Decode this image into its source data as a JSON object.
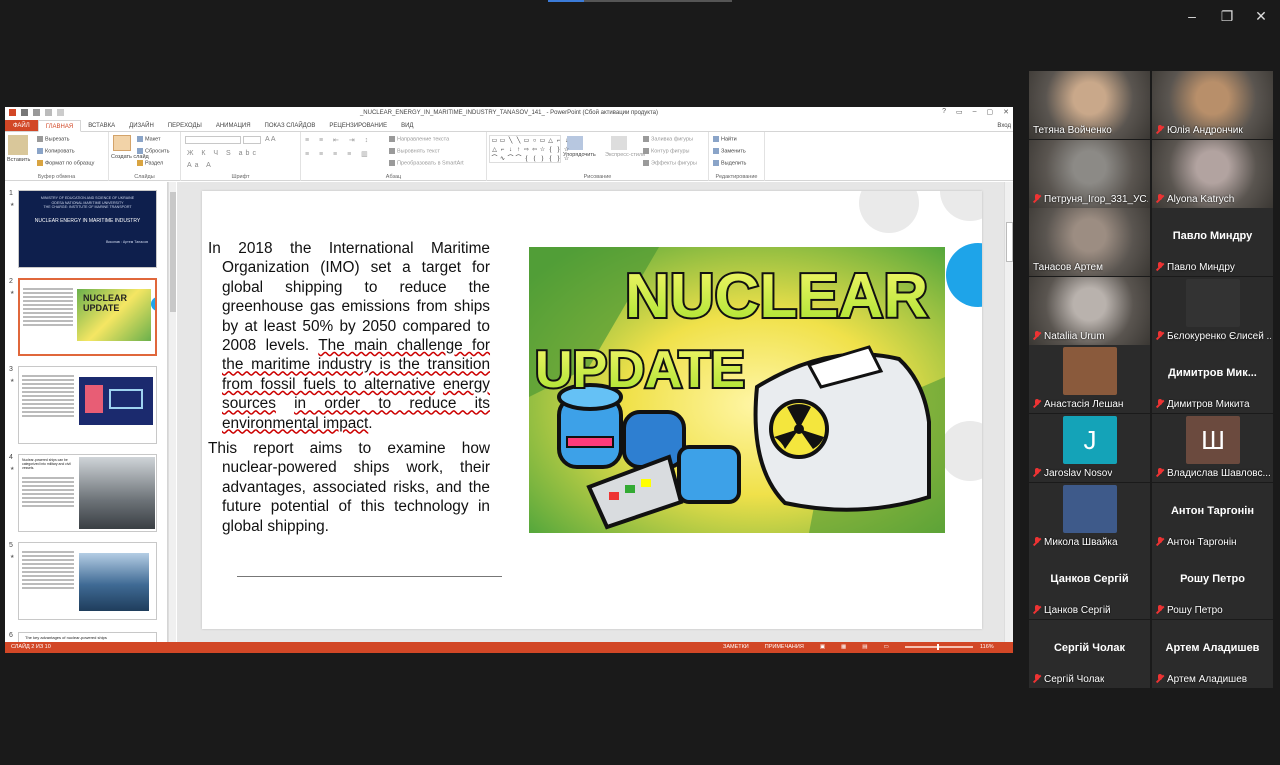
{
  "ppt": {
    "window_title": "_NUCLEAR_ENERGY_IN_MARITIME_INDUSTRY_TANASOV_141_ - PowerPoint (Сбой активации продукта)",
    "account": "Вход",
    "window_controls": [
      "?",
      "▭",
      "–",
      "▢",
      "✕"
    ],
    "tabs": [
      "ФАЙЛ",
      "ГЛАВНАЯ",
      "ВСТАВКА",
      "ДИЗАЙН",
      "ПЕРЕХОДЫ",
      "АНИМАЦИЯ",
      "ПОКАЗ СЛАЙДОВ",
      "РЕЦЕНЗИРОВАНИЕ",
      "ВИД"
    ],
    "active_tab": "ГЛАВНАЯ",
    "ribbon": {
      "clipboard": {
        "label": "Буфер обмена",
        "paste": "Вставить",
        "cut": "Вырезать",
        "copy": "Копировать",
        "format": "Формат по образцу"
      },
      "slides": {
        "label": "Слайды",
        "new_slide": "Создать слайд",
        "layout": "Макет",
        "reset": "Сбросить",
        "section": "Раздел"
      },
      "font": {
        "label": "Шрифт"
      },
      "paragraph": {
        "label": "Абзац",
        "text_dir": "Направление текста",
        "align_text": "Выровнять текст",
        "smartart": "Преобразовать в SmartArt"
      },
      "drawing": {
        "label": "Рисование",
        "arrange": "Упорядочить",
        "styles": "Экспресс-стили",
        "fill": "Заливка фигуры",
        "outline": "Контур фигуры",
        "effects": "Эффекты фигуры"
      },
      "editing": {
        "label": "Редактирование",
        "find": "Найти",
        "replace": "Заменить",
        "select": "Выделить"
      }
    },
    "thumbnails": [
      {
        "num": "1",
        "title_lines": [
          "MINISTRY OF EDUCATION AND SCIENCE OF UKRAINE",
          "ODESA NATIONAL MARITIME UNIVERSITY",
          "THE CHARGE: INSTITUTE OF MARINE TRANSPORT"
        ],
        "heading": "NUCLEAR ENERGY IN MARITIME INDUSTRY",
        "footer": "Виконав : Артем Танасов"
      },
      {
        "num": "2",
        "badge": "NUCLEAR UPDATE"
      },
      {
        "num": "3"
      },
      {
        "num": "4",
        "text": "Nuclear-powered ships can be categorized into military and civil vessels."
      },
      {
        "num": "5"
      },
      {
        "num": "6",
        "text": "The key advantages of nuclear-powered ships"
      }
    ],
    "slide": {
      "paragraph1_plain": "In 2018 the International Maritime Organization (IMO) set a target for global shipping to reduce the greenhouse gas emissions from ships by at least 50% by 2050 compared to 2008 levels.",
      "paragraph1_pre": "The main challenge for the maritime industry is the transition from fossil fuels to alternative",
      "paragraph1_energy": "energy sources",
      "paragraph1_post": "in order to reduce its environmental impact",
      "paragraph1_end": ".",
      "paragraph2": "This report aims to examine how nuclear-powered ships work, their advantages, associated risks, and the future potential of this technology in global shipping.",
      "image_line1": "NUCLEAR",
      "image_line2": "UPDATE"
    },
    "status": {
      "slide_counter": "СЛАЙД 2 ИЗ 10",
      "notes": "ЗАМЕТКИ",
      "comments": "ПРИМЕЧАНИЯ",
      "zoom": "116%"
    }
  },
  "participants": [
    {
      "name": "Тетяна Войченко",
      "muted": false,
      "kind": "photo",
      "color": "#c9a88a"
    },
    {
      "name": "Юлія Андрончик",
      "muted": true,
      "kind": "photo",
      "color": "#b88f6a"
    },
    {
      "name": "Петруня_Ігор_331_УС...",
      "muted": true,
      "kind": "photo",
      "color": "#8c8a86"
    },
    {
      "name": "Alyona Katrych",
      "muted": true,
      "kind": "photo",
      "color": "#b2a3a0"
    },
    {
      "name": "Танасов Артем",
      "muted": false,
      "kind": "photo",
      "color": "#9c8d82",
      "active": true
    },
    {
      "name": "Павло Миндру",
      "muted": true,
      "kind": "name",
      "display": "Павло Миндру"
    },
    {
      "name": "Nataliia Urum",
      "muted": true,
      "kind": "photo",
      "color": "#b9b2ad"
    },
    {
      "name": "Бєлокуренко Єлисей ...",
      "muted": true,
      "kind": "avatar",
      "letter": "",
      "color": "#333"
    },
    {
      "name": "Анастасія Лешан",
      "muted": true,
      "kind": "avatar",
      "letter": "",
      "color": "#8a5a3c"
    },
    {
      "name": "Димитров Микита",
      "muted": true,
      "kind": "name",
      "display": "Димитров Мик..."
    },
    {
      "name": "Jaroslav Nosov",
      "muted": true,
      "kind": "avatar",
      "letter": "J",
      "color": "#14a3b8"
    },
    {
      "name": "Владислав Шавловс...",
      "muted": true,
      "kind": "avatar",
      "letter": "Ш",
      "color": "#6b4a3e"
    },
    {
      "name": "Микола Швайка",
      "muted": true,
      "kind": "avatar",
      "letter": "",
      "color": "#3e5a8a"
    },
    {
      "name": "Антон Таргонін",
      "muted": true,
      "kind": "name",
      "display": "Антон Таргонін"
    },
    {
      "name": "Цанков Сергій",
      "muted": true,
      "kind": "name",
      "display": "Цанков Сергій"
    },
    {
      "name": "Рошу Петро",
      "muted": true,
      "kind": "name",
      "display": "Рошу Петро"
    },
    {
      "name": "Сергій Чолак",
      "muted": true,
      "kind": "name",
      "display": "Сергій Чолак"
    },
    {
      "name": "Артем Аладишев",
      "muted": true,
      "kind": "name",
      "display": "Артем Аладишев"
    }
  ],
  "colors": {
    "ppt_accent": "#d24726",
    "active_speaker": "#4ec9a5",
    "muted": "#e33333"
  }
}
